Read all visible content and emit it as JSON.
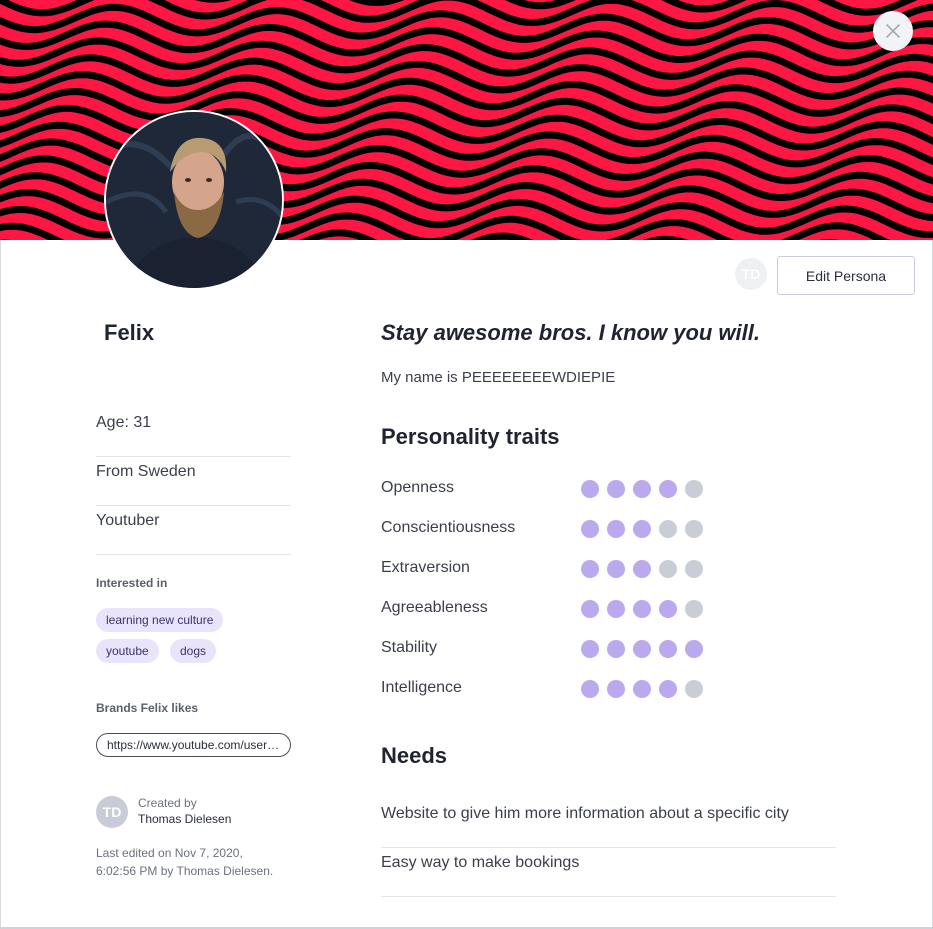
{
  "persona": {
    "name": "Felix",
    "edit_label": "Edit Persona",
    "owner_initials": "TD",
    "quote": "Stay awesome bros. I know you will.",
    "bio": "My name is PEEEEEEEEWDIEPIE"
  },
  "colors": {
    "banner_red": "#ff1744",
    "banner_black": "#000000",
    "dot_on": "#bba9ee",
    "dot_off": "#c9ced6",
    "chip_bg": "#e9e4fb"
  },
  "facts": [
    "Age: 31",
    "From Sweden",
    "Youtuber"
  ],
  "interests": {
    "label": "Interested in",
    "tags": [
      "learning new culture",
      "youtube",
      "dogs"
    ]
  },
  "brands": {
    "label": "Brands Felix likes",
    "links": [
      "https://www.youtube.com/user/PewDiePie"
    ]
  },
  "creator": {
    "initials": "TD",
    "label": "Created by",
    "name": "Thomas Dielesen",
    "edited_line1": "Last edited on Nov 7, 2020,",
    "edited_line2": "6:02:56 PM by Thomas Dielesen."
  },
  "personality": {
    "title": "Personality traits",
    "scale_max": 5,
    "traits": [
      {
        "label": "Openness",
        "level": 4
      },
      {
        "label": "Conscientiousness",
        "level": 3
      },
      {
        "label": "Extraversion",
        "level": 3
      },
      {
        "label": "Agreeableness",
        "level": 4
      },
      {
        "label": "Stability",
        "level": 5
      },
      {
        "label": "Intelligence",
        "level": 4
      }
    ]
  },
  "needs": {
    "title": "Needs",
    "items": [
      "Website to give him more information about a specific city",
      "Easy way to make bookings"
    ]
  },
  "icons": {
    "close": "close-icon",
    "avatar": "profile-photo"
  }
}
